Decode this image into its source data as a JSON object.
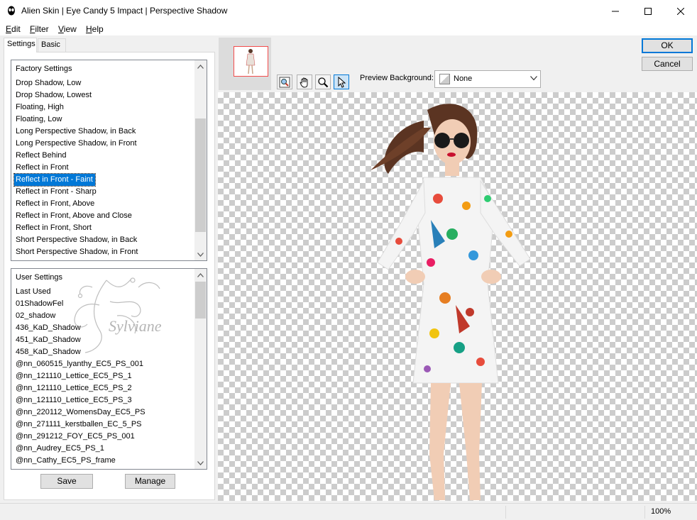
{
  "window": {
    "title": "Alien Skin | Eye Candy 5 Impact | Perspective Shadow",
    "controls": {
      "minimize": "minimize-icon",
      "maximize": "maximize-icon",
      "close": "close-icon"
    }
  },
  "menu": {
    "items": [
      {
        "label": "Edit"
      },
      {
        "label": "Filter"
      },
      {
        "label": "View"
      },
      {
        "label": "Help"
      }
    ]
  },
  "tabs": [
    {
      "label": "Settings",
      "active": true
    },
    {
      "label": "Basic",
      "active": false
    }
  ],
  "factory_settings": {
    "header": "Factory Settings",
    "items": [
      "Drop Shadow, Low",
      "Drop Shadow, Lowest",
      "Floating, High",
      "Floating, Low",
      "Long Perspective Shadow, in Back",
      "Long Perspective Shadow, in Front",
      "Reflect Behind",
      "Reflect in Front",
      "Reflect in Front - Faint",
      "Reflect in Front - Sharp",
      "Reflect in Front, Above",
      "Reflect in Front, Above and Close",
      "Reflect in Front, Short",
      "Short Perspective Shadow, in Back",
      "Short Perspective Shadow, in Front"
    ],
    "selected": "Reflect in Front - Faint"
  },
  "user_settings": {
    "header": "User Settings",
    "items": [
      "Last Used",
      "01ShadowFel",
      "02_shadow",
      "436_KaD_Shadow",
      "451_KaD_Shadow",
      "458_KaD_Shadow",
      "@nn_060515_lyanthy_EC5_PS_001",
      "@nn_121110_Lettice_EC5_PS_1",
      "@nn_121110_Lettice_EC5_PS_2",
      "@nn_121110_Lettice_EC5_PS_3",
      "@nn_220112_WomensDay_EC5_PS",
      "@nn_271111_kerstballen_EC_5_PS",
      "@nn_291212_FOY_EC5_PS_001",
      "@nn_Audrey_EC5_PS_1",
      "@nn_Cathy_EC5_PS_frame"
    ]
  },
  "watermark": {
    "text": "Sylviane"
  },
  "buttons": {
    "save": "Save",
    "manage": "Manage",
    "ok": "OK",
    "cancel": "Cancel"
  },
  "toolbar": {
    "tools": [
      "zoom-fit-icon",
      "hand-icon",
      "magnifier-icon",
      "pointer-icon"
    ],
    "preview_background_label": "Preview Background:",
    "preview_background_value": "None"
  },
  "status": {
    "zoom": "100%"
  },
  "colors": {
    "selection": "#0078d7",
    "thumbnail_border": "#f34c4c",
    "checker_dark": "#cccccc",
    "checker_light": "#ffffff"
  }
}
